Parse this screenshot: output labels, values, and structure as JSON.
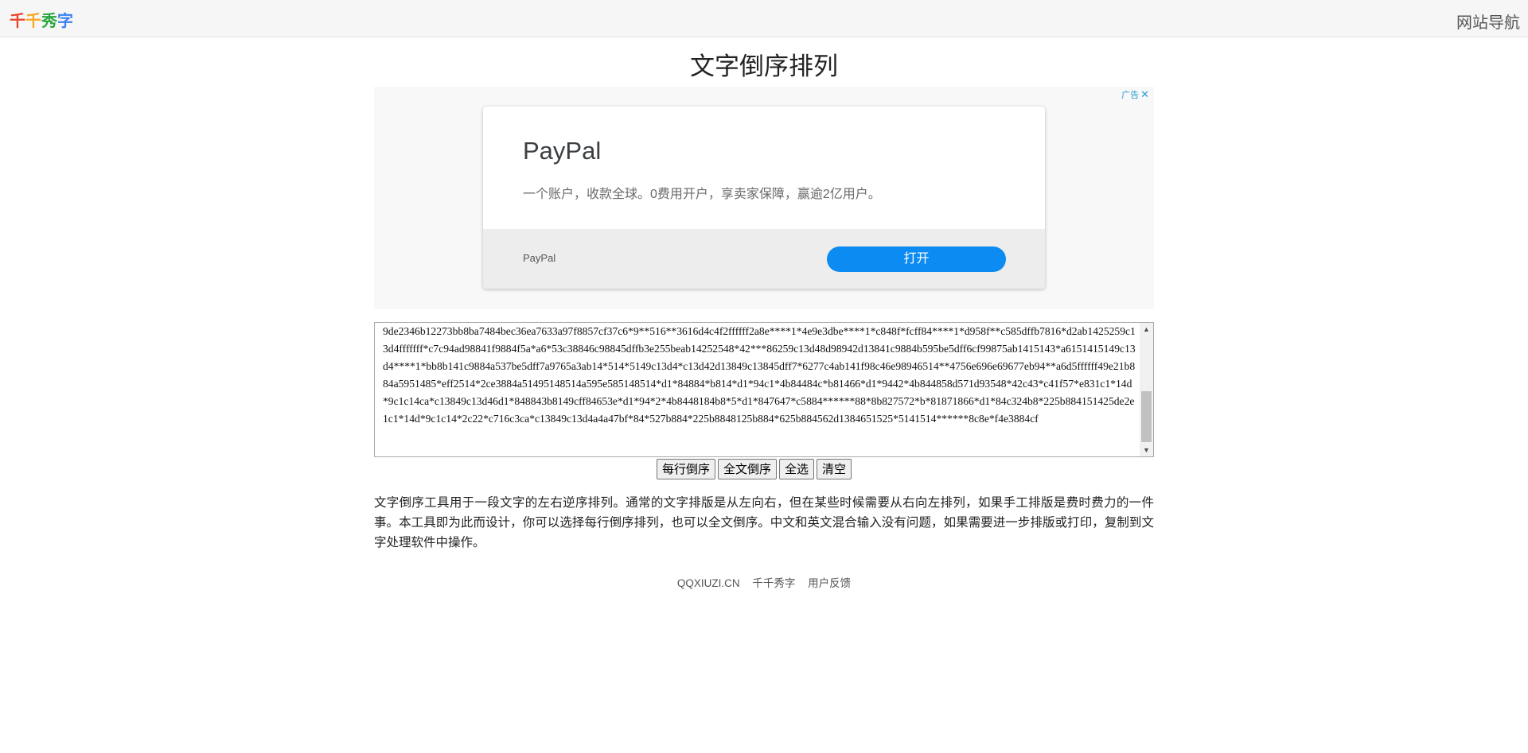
{
  "header": {
    "logo_chars": [
      {
        "char": "千",
        "color": "#e8452c"
      },
      {
        "char": "千",
        "color": "#f7a825"
      },
      {
        "char": "秀",
        "color": "#2aa63e"
      },
      {
        "char": "字",
        "color": "#3a80f5"
      }
    ],
    "nav_label": "网站导航"
  },
  "page": {
    "title": "文字倒序排列"
  },
  "ad": {
    "badge_label": "广告",
    "close_glyph": "✕",
    "brand_title": "PayPal",
    "description": "一个账户，收款全球。0费用开户，享卖家保障，赢逾2亿用户。",
    "brand_small": "PayPal",
    "open_button": "打开"
  },
  "editor": {
    "text": "9de2346b12273bb8ba7484bec36ea7633a97f8857cf37c6*9**516**3616d4c4f2ffffff2a8e****1*4e9e3dbe****1*c848f*fcff84****1*d958f**c585dffb7816*d2ab1425259c13d4fffffff*c7c94ad98841f9884f5a*a6*53c38846c98845dffb3e255beab14252548*42***86259c13d48d98942d13841c9884b595be5dff6cf99875ab1415143*a6151415149c13d4****1*bb8b141c9884a537be5dff7a9765a3ab14*514*5149c13d4*c13d42d13849c13845dff7*6277c4ab141f98c46e98946514**4756e696e69677eb94**a6d5ffffff49e21b884a5951485*eff2514*2ce3884a51495148514a595e585148514*d1*84884*b814*d1*94c1*4b84484c*b81466*d1*9442*4b844858d571d93548*42c43*c41f57*e831c1*14d*9c1c14ca*c13849c13d46d1*848843b8149cff84653e*d1*94*2*4b8448184b8*5*d1*847647*c5884******88*8b827572*b*81871866*d1*84c324b8*225b884151425de2e1c1*14d*9c1c14*2c22*c716c3ca*c13849c13d4a4a47bf*84*527b884*225b8848125b884*625b884562d1384651525*5141514******8c8e*f4e3884cf",
    "scroll_up": "▲",
    "scroll_down": "▼"
  },
  "buttons": {
    "reverse_each_line": "每行倒序",
    "reverse_all": "全文倒序",
    "select_all": "全选",
    "clear": "清空"
  },
  "description": "文字倒序工具用于一段文字的左右逆序排列。通常的文字排版是从左向右，但在某些时候需要从右向左排列，如果手工排版是费时费力的一件事。本工具即为此而设计，你可以选择每行倒序排列，也可以全文倒序。中文和英文混合输入没有问题，如果需要进一步排版或打印，复制到文字处理软件中操作。",
  "footer": {
    "domain": "QQXIUZI.CN",
    "site_name": "千千秀字",
    "feedback": "用户反馈"
  }
}
